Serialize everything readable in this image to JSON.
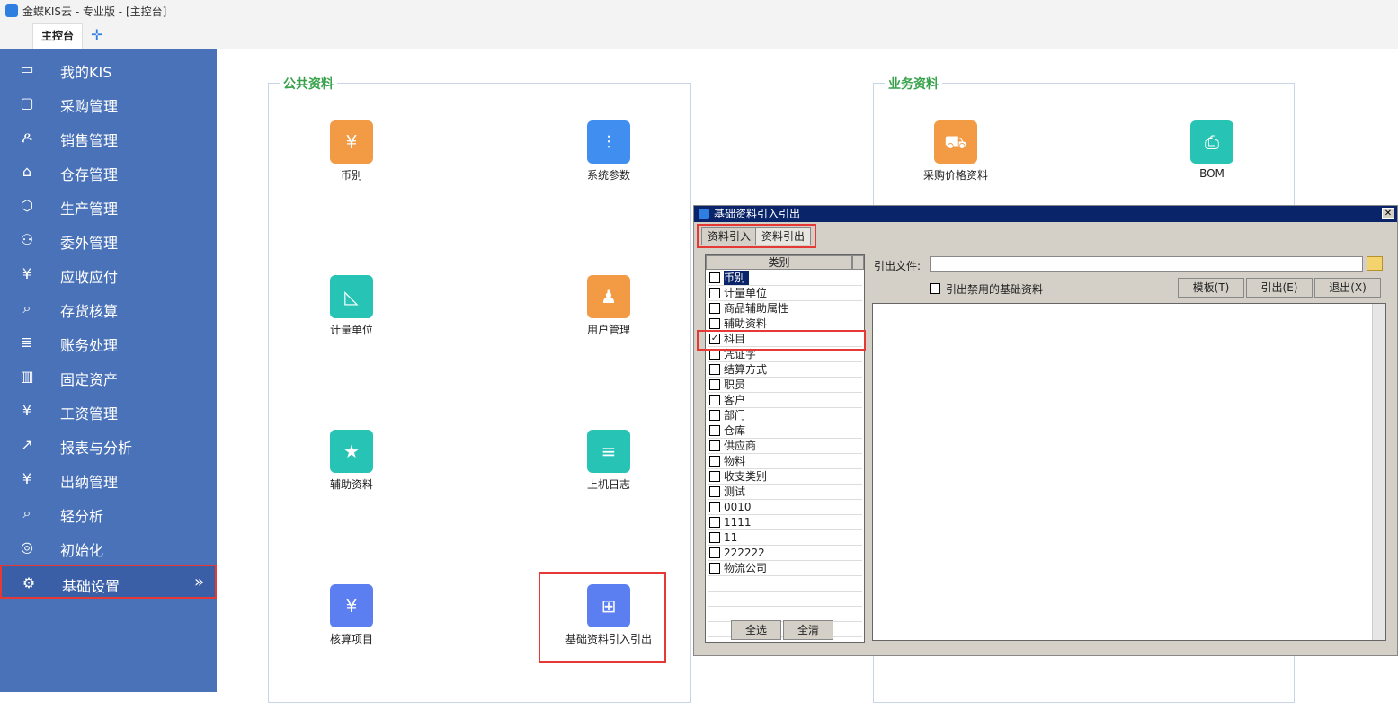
{
  "window": {
    "title": "金蝶KIS云 - 专业版 - [主控台]"
  },
  "tabs": {
    "main": "主控台",
    "add": "✛"
  },
  "sidebar": {
    "items": [
      {
        "label": "我的KIS",
        "icon": "monitor-icon",
        "glyph": "▭"
      },
      {
        "label": "采购管理",
        "icon": "purchase-icon",
        "glyph": "▢"
      },
      {
        "label": "销售管理",
        "icon": "users-icon",
        "glyph": "ዶ"
      },
      {
        "label": "仓存管理",
        "icon": "warehouse-icon",
        "glyph": "⌂"
      },
      {
        "label": "生产管理",
        "icon": "production-icon",
        "glyph": "⬡"
      },
      {
        "label": "委外管理",
        "icon": "outsource-icon",
        "glyph": "⚇"
      },
      {
        "label": "应收应付",
        "icon": "receivable-icon",
        "glyph": "¥"
      },
      {
        "label": "存货核算",
        "icon": "inventory-icon",
        "glyph": "⌕"
      },
      {
        "label": "账务处理",
        "icon": "ledger-icon",
        "glyph": "≣"
      },
      {
        "label": "固定资产",
        "icon": "building-icon",
        "glyph": "▥"
      },
      {
        "label": "工资管理",
        "icon": "salary-icon",
        "glyph": "¥"
      },
      {
        "label": "报表与分析",
        "icon": "chart-icon",
        "glyph": "↗"
      },
      {
        "label": "出纳管理",
        "icon": "cashier-icon",
        "glyph": "¥"
      },
      {
        "label": "轻分析",
        "icon": "analysis-icon",
        "glyph": "⌕"
      },
      {
        "label": "初始化",
        "icon": "init-icon",
        "glyph": "◎"
      },
      {
        "label": "基础设置",
        "icon": "gear-icon",
        "glyph": "⚙",
        "active": true,
        "arrow": "»"
      }
    ]
  },
  "public": {
    "title": "公共资料",
    "tiles": [
      {
        "label": "币别",
        "icon": "currency-icon",
        "glyph": "¥",
        "color": "#f39a45"
      },
      {
        "label": "系统参数",
        "icon": "settings-sliders-icon",
        "glyph": "⫶",
        "color": "#3f8ef0"
      },
      {
        "label": "计量单位",
        "icon": "ruler-icon",
        "glyph": "◺",
        "color": "#27c4b5"
      },
      {
        "label": "用户管理",
        "icon": "user-gear-icon",
        "glyph": "♟",
        "color": "#f39a45"
      },
      {
        "label": "辅助资料",
        "icon": "book-star-icon",
        "glyph": "★",
        "color": "#27c4b5"
      },
      {
        "label": "上机日志",
        "icon": "log-doc-icon",
        "glyph": "≡",
        "color": "#27c4b5"
      },
      {
        "label": "核算项目",
        "icon": "accounting-item-icon",
        "glyph": "¥",
        "color": "#5b7ff0"
      },
      {
        "label": "基础资料引入引出",
        "icon": "import-export-icon",
        "glyph": "⊞",
        "color": "#5b7ff0"
      }
    ]
  },
  "business": {
    "title": "业务资料",
    "tiles": [
      {
        "label": "采购价格资料",
        "icon": "cart-icon",
        "glyph": "⛟",
        "color": "#f39a45"
      },
      {
        "label": "BOM",
        "icon": "printer-icon",
        "glyph": "⎙",
        "color": "#27c4b5"
      }
    ]
  },
  "dialog": {
    "title": "基础资料引入引出",
    "close": "✕",
    "tabs": [
      "资料引入",
      "资料引出"
    ],
    "list_header": "类别",
    "categories": [
      {
        "label": "币别",
        "checked": false,
        "selected": true
      },
      {
        "label": "计量单位",
        "checked": false
      },
      {
        "label": "商品辅助属性",
        "checked": false
      },
      {
        "label": "辅助资料",
        "checked": false
      },
      {
        "label": "科目",
        "checked": true
      },
      {
        "label": "凭证字",
        "checked": false
      },
      {
        "label": "结算方式",
        "checked": false
      },
      {
        "label": "职员",
        "checked": false
      },
      {
        "label": "客户",
        "checked": false
      },
      {
        "label": "部门",
        "checked": false
      },
      {
        "label": "仓库",
        "checked": false
      },
      {
        "label": "供应商",
        "checked": false
      },
      {
        "label": "物料",
        "checked": false
      },
      {
        "label": "收支类别",
        "checked": false
      },
      {
        "label": "测试",
        "checked": false
      },
      {
        "label": "0010",
        "checked": false
      },
      {
        "label": "1111",
        "checked": false
      },
      {
        "label": "11",
        "checked": false
      },
      {
        "label": "222222",
        "checked": false
      },
      {
        "label": "物流公司",
        "checked": false
      }
    ],
    "select_all": "全选",
    "clear_all": "全清",
    "export_file_label": "引出文件:",
    "export_file_value": "",
    "export_disabled_label": "引出禁用的基础资料",
    "template_button": "模板(T)",
    "export_button": "引出(E)",
    "exit_button": "退出(X)"
  }
}
